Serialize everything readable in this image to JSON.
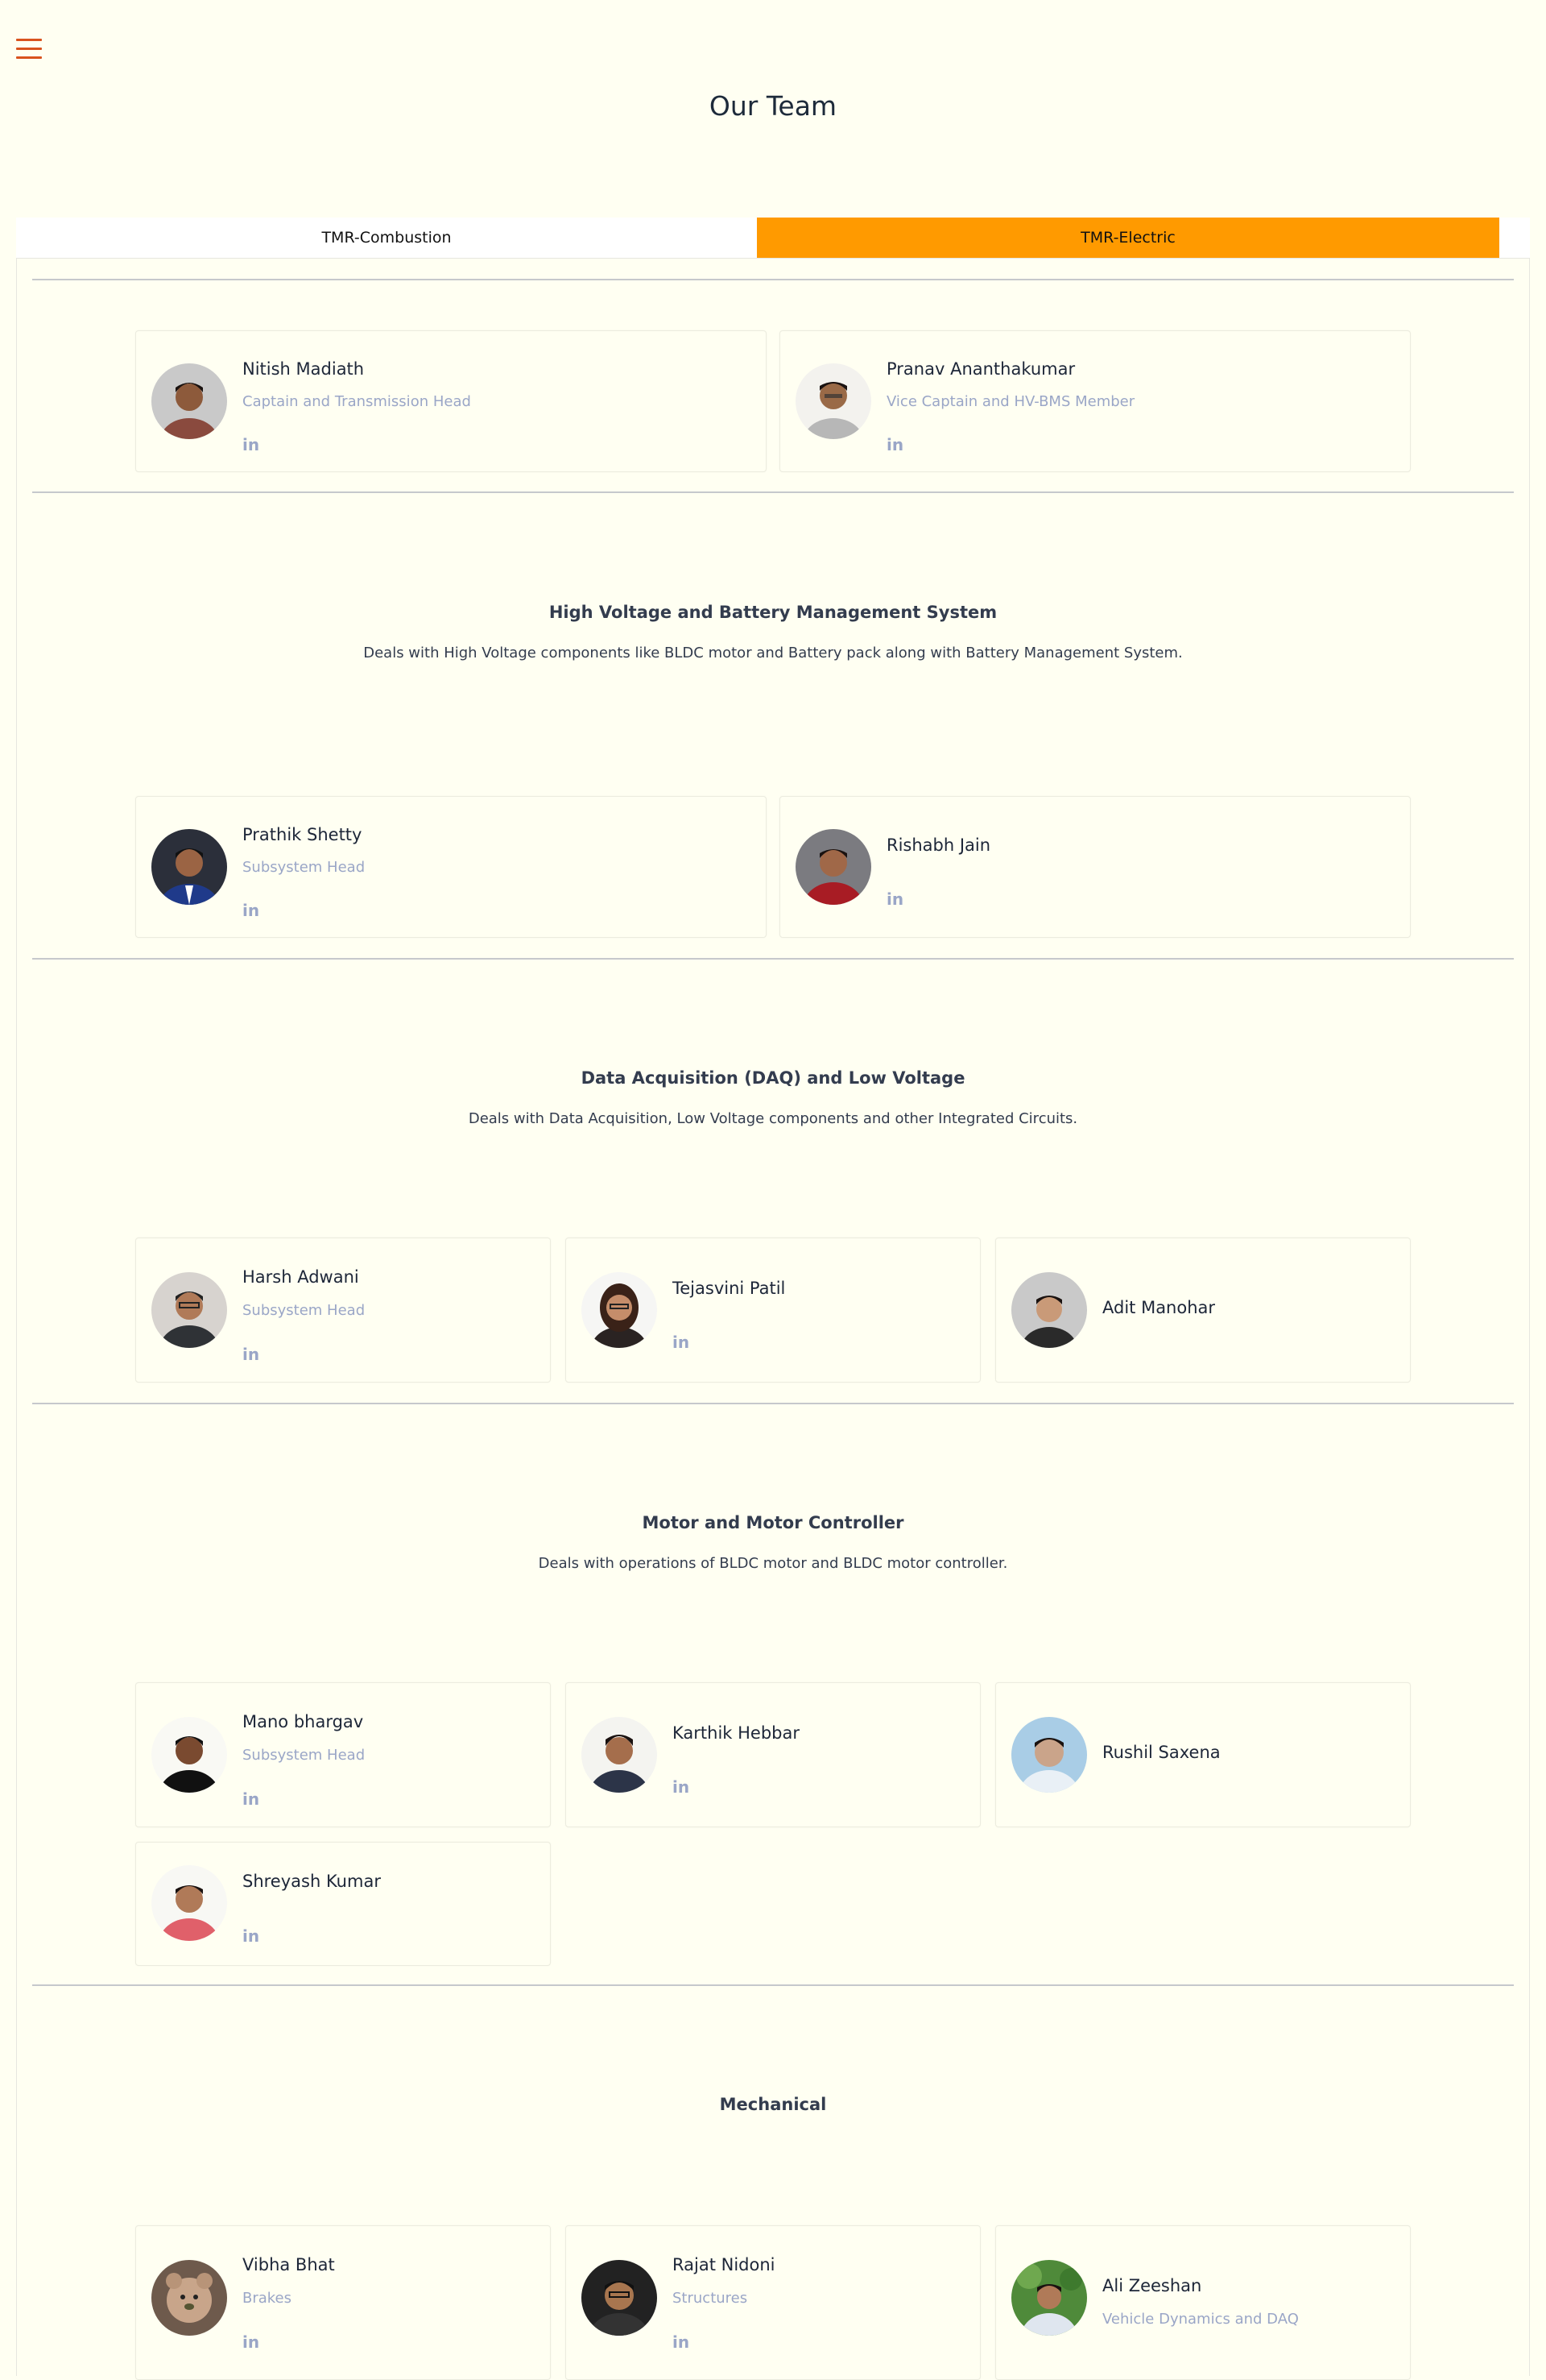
{
  "page_title": "Our Team",
  "tabs": [
    "TMR-Combustion",
    "TMR-Electric"
  ],
  "active_tab": "TMR-Electric",
  "linkedin_label": "in",
  "colors": {
    "background": "#fffff2",
    "accent_tab": "#ff9a00",
    "menu_icon": "#d9531e",
    "role_text": "#9aa6c7"
  },
  "leaders": [
    {
      "name": "Nitish Madiath",
      "role": "Captain and Transmission Head",
      "linkedin": true
    },
    {
      "name": "Pranav Ananthakumar",
      "role": "Vice Captain and HV-BMS Member",
      "linkedin": true
    }
  ],
  "sections": [
    {
      "title": "High Voltage and Battery Management System",
      "description": "Deals with High Voltage components like BLDC motor and Battery pack along with Battery Management System.",
      "members": [
        {
          "name": "Prathik Shetty",
          "role": "Subsystem Head",
          "linkedin": true
        },
        {
          "name": "Rishabh Jain",
          "role": "",
          "linkedin": true
        }
      ]
    },
    {
      "title": "Data Acquisition (DAQ) and Low Voltage",
      "description": "Deals with Data Acquisition, Low Voltage components and other Integrated Circuits.",
      "members": [
        {
          "name": "Harsh Adwani",
          "role": "Subsystem Head",
          "linkedin": true
        },
        {
          "name": "Tejasvini Patil",
          "role": "",
          "linkedin": true
        },
        {
          "name": "Adit Manohar",
          "role": "",
          "linkedin": false
        }
      ]
    },
    {
      "title": "Motor and Motor Controller",
      "description": "Deals with operations of BLDC motor and BLDC motor controller.",
      "members": [
        {
          "name": "Mano bhargav",
          "role": "Subsystem Head",
          "linkedin": true
        },
        {
          "name": "Karthik Hebbar",
          "role": "",
          "linkedin": true
        },
        {
          "name": "Rushil Saxena",
          "role": "",
          "linkedin": false
        },
        {
          "name": "Shreyash Kumar",
          "role": "",
          "linkedin": true
        }
      ]
    },
    {
      "title": "Mechanical",
      "description": "",
      "members": [
        {
          "name": "Vibha Bhat",
          "role": "Brakes",
          "linkedin": true
        },
        {
          "name": "Rajat Nidoni",
          "role": "Structures",
          "linkedin": true
        },
        {
          "name": "Ali Zeeshan",
          "role": "Vehicle Dynamics and DAQ",
          "linkedin": false
        }
      ]
    }
  ]
}
